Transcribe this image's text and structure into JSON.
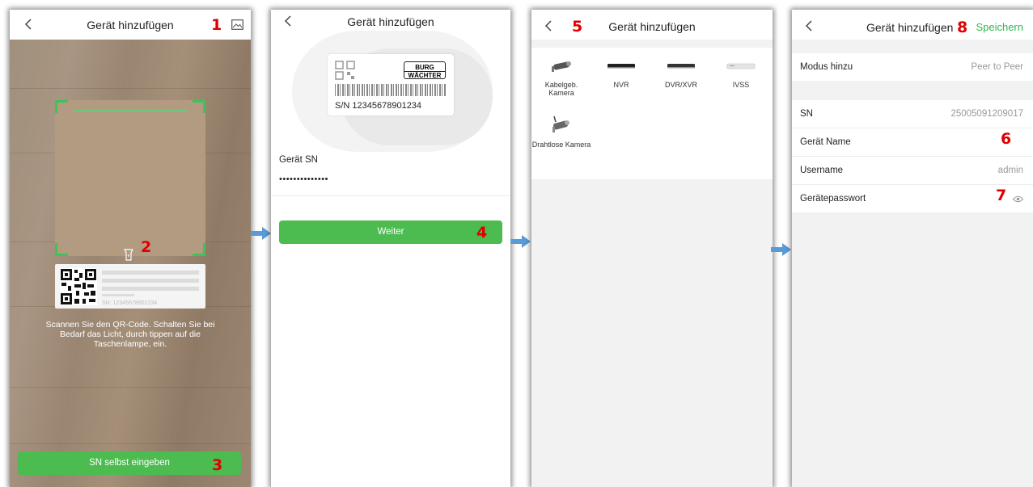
{
  "colors": {
    "accent_green": "#4cbc50",
    "save_green": "#2fb84c",
    "marker_red": "#e00000",
    "arrow_blue": "#5b9bd5"
  },
  "screen1": {
    "title": "Gerät hinzufügen",
    "marker_1": "1",
    "marker_2": "2",
    "marker_3": "3",
    "qr_card_sn": "SN: 12345678901234",
    "instruction": "Scannen Sie den QR-Code. Schalten Sie bei Bedarf das Licht, durch tippen auf die Taschenlampe, ein.",
    "manual_sn_button": "SN selbst eingeben",
    "icons": {
      "back": "chevron-left-icon",
      "gallery": "image-icon",
      "flashlight": "flashlight-icon"
    }
  },
  "screen2": {
    "title": "Gerät hinzufügen",
    "brand_line1": "BURG",
    "brand_line2": "WÄCHTER",
    "printed_sn": "S/N 12345678901234",
    "sn_label": "Gerät SN",
    "sn_value": "••••••••••••••",
    "next_button": "Weiter",
    "marker_4": "4"
  },
  "screen3": {
    "title": "Gerät hinzufügen",
    "marker_5": "5",
    "device_types": [
      {
        "label": "Kabelgeb. Kamera",
        "icon": "wired-camera-icon"
      },
      {
        "label": "NVR",
        "icon": "nvr-icon"
      },
      {
        "label": "DVR/XVR",
        "icon": "dvr-icon"
      },
      {
        "label": "IVSS",
        "icon": "ivss-icon"
      },
      {
        "label": "Drahtlose Kamera",
        "icon": "wireless-camera-icon"
      }
    ]
  },
  "screen4": {
    "title": "Gerät hinzufügen",
    "save_button": "Speichern",
    "marker_6": "6",
    "marker_7": "7",
    "marker_8": "8",
    "mode_label": "Modus hinzu",
    "mode_value": "Peer to Peer",
    "sn_label": "SN",
    "sn_value": "25005091209017",
    "name_label": "Gerät Name",
    "username_label": "Username",
    "username_value": "admin",
    "password_label": "Gerätepasswort"
  }
}
